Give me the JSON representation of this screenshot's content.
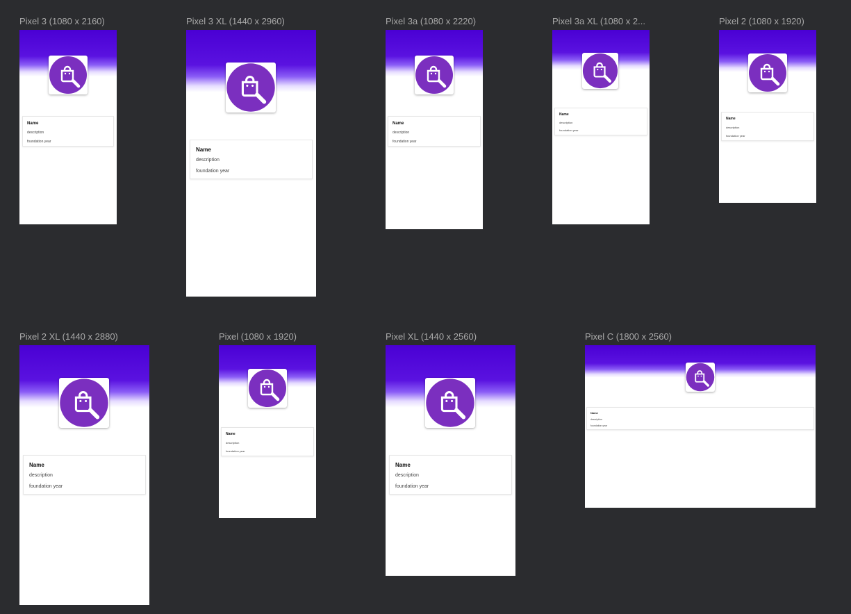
{
  "devices": [
    {
      "label": "Pixel 3 (1080 x 2160)",
      "card": {
        "name": "Name",
        "description": "description",
        "year": "foundation year"
      }
    },
    {
      "label": "Pixel 3 XL (1440 x 2960)",
      "card": {
        "name": "Name",
        "description": "description",
        "year": "foundation year"
      }
    },
    {
      "label": "Pixel 3a (1080 x 2220)",
      "card": {
        "name": "Name",
        "description": "description",
        "year": "foundation year"
      }
    },
    {
      "label": "Pixel 3a XL (1080 x 2...",
      "card": {
        "name": "Name",
        "description": "description",
        "year": "foundation year"
      }
    },
    {
      "label": "Pixel 2 (1080 x 1920)",
      "card": {
        "name": "Name",
        "description": "description",
        "year": "foundation year"
      }
    },
    {
      "label": "Pixel 2 XL (1440 x 2880)",
      "card": {
        "name": "Name",
        "description": "description",
        "year": "foundation year"
      }
    },
    {
      "label": "Pixel (1080 x 1920)",
      "card": {
        "name": "Name",
        "description": "description",
        "year": "foundation year"
      }
    },
    {
      "label": "Pixel XL (1440 x 2560)",
      "card": {
        "name": "Name",
        "description": "description",
        "year": "foundation year"
      }
    },
    {
      "label": "Pixel C (1800 x 2560)",
      "card": {
        "name": "Name",
        "description": "description",
        "year": "foundation year"
      }
    }
  ],
  "icon": {
    "name": "shopping-bag-search-icon",
    "color": "#7b2fbf"
  },
  "colors": {
    "background": "#2b2c2f",
    "header_top": "#4a00d4",
    "label": "#a9a9a9"
  }
}
